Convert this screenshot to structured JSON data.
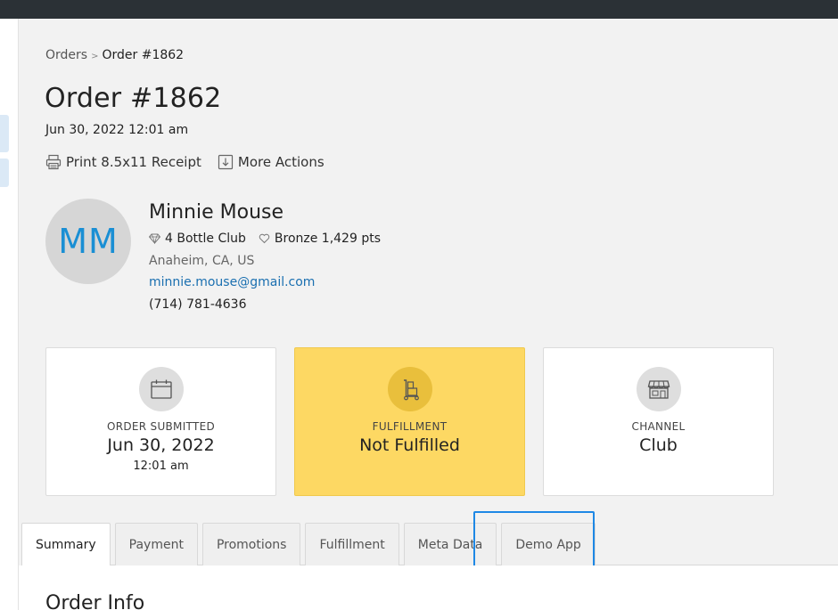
{
  "breadcrumb": {
    "root": "Orders",
    "separator": ">",
    "current": "Order #1862"
  },
  "order": {
    "title": "Order #1862",
    "date": "Jun 30, 2022 12:01 am"
  },
  "actions": {
    "print": "Print 8.5x11 Receipt",
    "more": "More Actions"
  },
  "customer": {
    "initials": "MM",
    "name": "Minnie Mouse",
    "club": "4 Bottle Club",
    "loyalty": "Bronze 1,429 pts",
    "location": "Anaheim, CA, US",
    "email": "minnie.mouse@gmail.com",
    "phone": "(714) 781-4636"
  },
  "cards": {
    "submitted": {
      "label": "ORDER SUBMITTED",
      "value": "Jun 30, 2022",
      "sub": "12:01 am",
      "icon": "calendar-icon"
    },
    "fulfillment": {
      "label": "FULFILLMENT",
      "value": "Not Fulfilled",
      "icon": "hand-truck-icon",
      "color": "#fdd863"
    },
    "channel": {
      "label": "CHANNEL",
      "value": "Club",
      "icon": "storefront-icon"
    }
  },
  "tabs": [
    {
      "label": "Summary"
    },
    {
      "label": "Payment"
    },
    {
      "label": "Promotions"
    },
    {
      "label": "Fulfillment"
    },
    {
      "label": "Meta Data"
    },
    {
      "label": "Demo App"
    }
  ],
  "section": {
    "title": "Order Info"
  },
  "colors": {
    "accent": "#1a8fd4",
    "link": "#1a6fb0",
    "highlight": "#1e88e5",
    "topbar": "#2b3136"
  }
}
